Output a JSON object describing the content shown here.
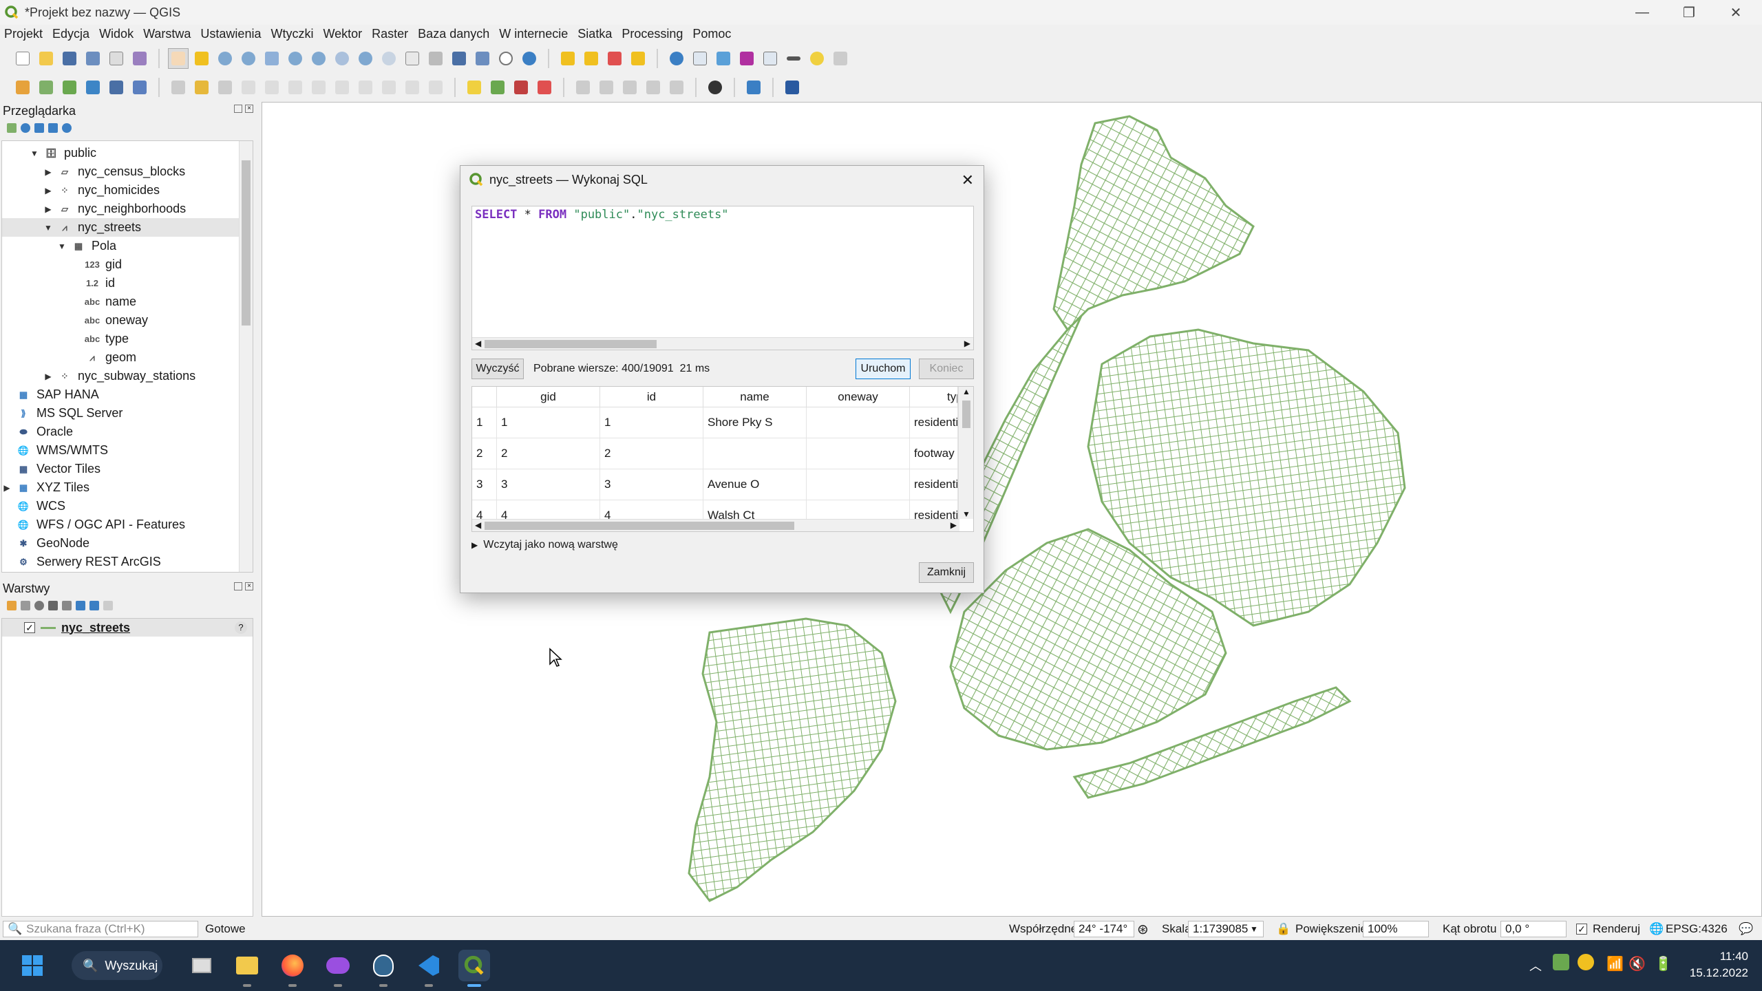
{
  "window": {
    "title": "*Projekt bez nazwy — QGIS"
  },
  "menu": [
    "Projekt",
    "Edycja",
    "Widok",
    "Warstwa",
    "Ustawienia",
    "Wtyczki",
    "Wektor",
    "Raster",
    "Baza danych",
    "W internecie",
    "Siatka",
    "Processing",
    "Pomoc"
  ],
  "browser": {
    "title": "Przeglądarka",
    "items": [
      {
        "label": "public",
        "icon": "database-schema-icon"
      },
      {
        "label": "nyc_census_blocks",
        "icon": "polygon-layer-icon"
      },
      {
        "label": "nyc_homicides",
        "icon": "point-layer-icon"
      },
      {
        "label": "nyc_neighborhoods",
        "icon": "polygon-layer-icon"
      },
      {
        "label": "nyc_streets",
        "icon": "line-layer-icon"
      },
      {
        "label": "Pola",
        "icon": "fields-table-icon"
      },
      {
        "label": "gid",
        "icon": "integer-field-icon",
        "type": "123"
      },
      {
        "label": "id",
        "icon": "double-field-icon",
        "type": "1.2"
      },
      {
        "label": "name",
        "icon": "string-field-icon",
        "type": "abc"
      },
      {
        "label": "oneway",
        "icon": "string-field-icon",
        "type": "abc"
      },
      {
        "label": "type",
        "icon": "string-field-icon",
        "type": "abc"
      },
      {
        "label": "geom",
        "icon": "geometry-field-icon"
      },
      {
        "label": "nyc_subway_stations",
        "icon": "point-layer-icon"
      },
      {
        "label": "SAP HANA",
        "icon": "sap-hana-icon"
      },
      {
        "label": "MS SQL Server",
        "icon": "mssql-icon"
      },
      {
        "label": "Oracle",
        "icon": "oracle-icon"
      },
      {
        "label": "WMS/WMTS",
        "icon": "globe-icon"
      },
      {
        "label": "Vector Tiles",
        "icon": "vector-tiles-icon"
      },
      {
        "label": "XYZ Tiles",
        "icon": "xyz-tiles-icon"
      },
      {
        "label": "WCS",
        "icon": "globe-icon"
      },
      {
        "label": "WFS / OGC API - Features",
        "icon": "globe-icon"
      },
      {
        "label": "GeoNode",
        "icon": "geonode-icon"
      },
      {
        "label": "Serwery REST ArcGIS",
        "icon": "arcgis-icon"
      }
    ]
  },
  "layers": {
    "title": "Warstwy",
    "items": [
      {
        "label": "nyc_streets",
        "checked": true
      }
    ]
  },
  "dialog": {
    "title": "nyc_streets — Wykonaj SQL",
    "sql": {
      "kw1": "SELECT",
      "star": " * ",
      "kw2": "FROM",
      "sp": " ",
      "s1": "\"public\"",
      "dot": ".",
      "s2": "\"nyc_streets\""
    },
    "clear_label": "Wyczyść",
    "status": "Pobrane wiersze: 400/19091  21 ms",
    "run_label": "Uruchom",
    "stop_label": "Koniec",
    "columns": [
      "gid",
      "id",
      "name",
      "oneway",
      "type"
    ],
    "rows": [
      {
        "n": "1",
        "gid": "1",
        "id": "1",
        "name": "Shore Pky S",
        "oneway": "",
        "type": "residential"
      },
      {
        "n": "2",
        "gid": "2",
        "id": "2",
        "name": "",
        "oneway": "",
        "type": "footway"
      },
      {
        "n": "3",
        "gid": "3",
        "id": "3",
        "name": "Avenue O",
        "oneway": "",
        "type": "residential"
      },
      {
        "n": "4",
        "gid": "4",
        "id": "4",
        "name": "Walsh Ct",
        "oneway": "",
        "type": "residential"
      }
    ],
    "load_as_layer": "Wczytaj jako nową warstwę",
    "close_label": "Zamknij"
  },
  "statusbar": {
    "search_placeholder": "Szukana fraza (Ctrl+K)",
    "ready": "Gotowe",
    "coords_label": "Współrzędne",
    "coords_value": "24° -174°",
    "scale_label": "Skala",
    "scale_value": "1:1739085",
    "zoom_label": "Powiększenie",
    "zoom_value": "100%",
    "rotation_label": "Kąt obrotu",
    "rotation_value": "0,0 °",
    "render_label": "Renderuj",
    "crs": "EPSG:4326"
  },
  "taskbar": {
    "search_label": "Wyszukaj",
    "time": "11:40",
    "date": "15.12.2022"
  },
  "colors": {
    "streets": "#7fb069",
    "accent": "#589632"
  }
}
